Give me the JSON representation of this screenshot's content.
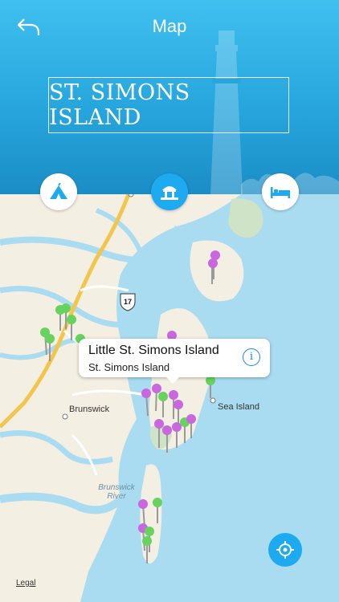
{
  "header": {
    "title": "Map",
    "banner": "ST. SIMONS ISLAND"
  },
  "map_labels": {
    "brunswick": "Brunswick",
    "sea_island": "Sea Island",
    "brunswick_river": "Brunswick\nRiver",
    "route": "17"
  },
  "callout": {
    "title": "Little St. Simons Island",
    "subtitle": "St. Simons Island"
  },
  "legal": "Legal",
  "icons": {
    "back": "back-arrow-icon",
    "camping": "tent-icon",
    "sights": "landmark-icon",
    "hotels": "bed-icon",
    "locate": "crosshair-icon"
  },
  "colors": {
    "header": "#27a6dd",
    "accent": "#1eaaf0",
    "water": "#a9dcf0",
    "land": "#f4efe3",
    "pin_purple": "#c867de",
    "pin_green": "#66d35e"
  }
}
